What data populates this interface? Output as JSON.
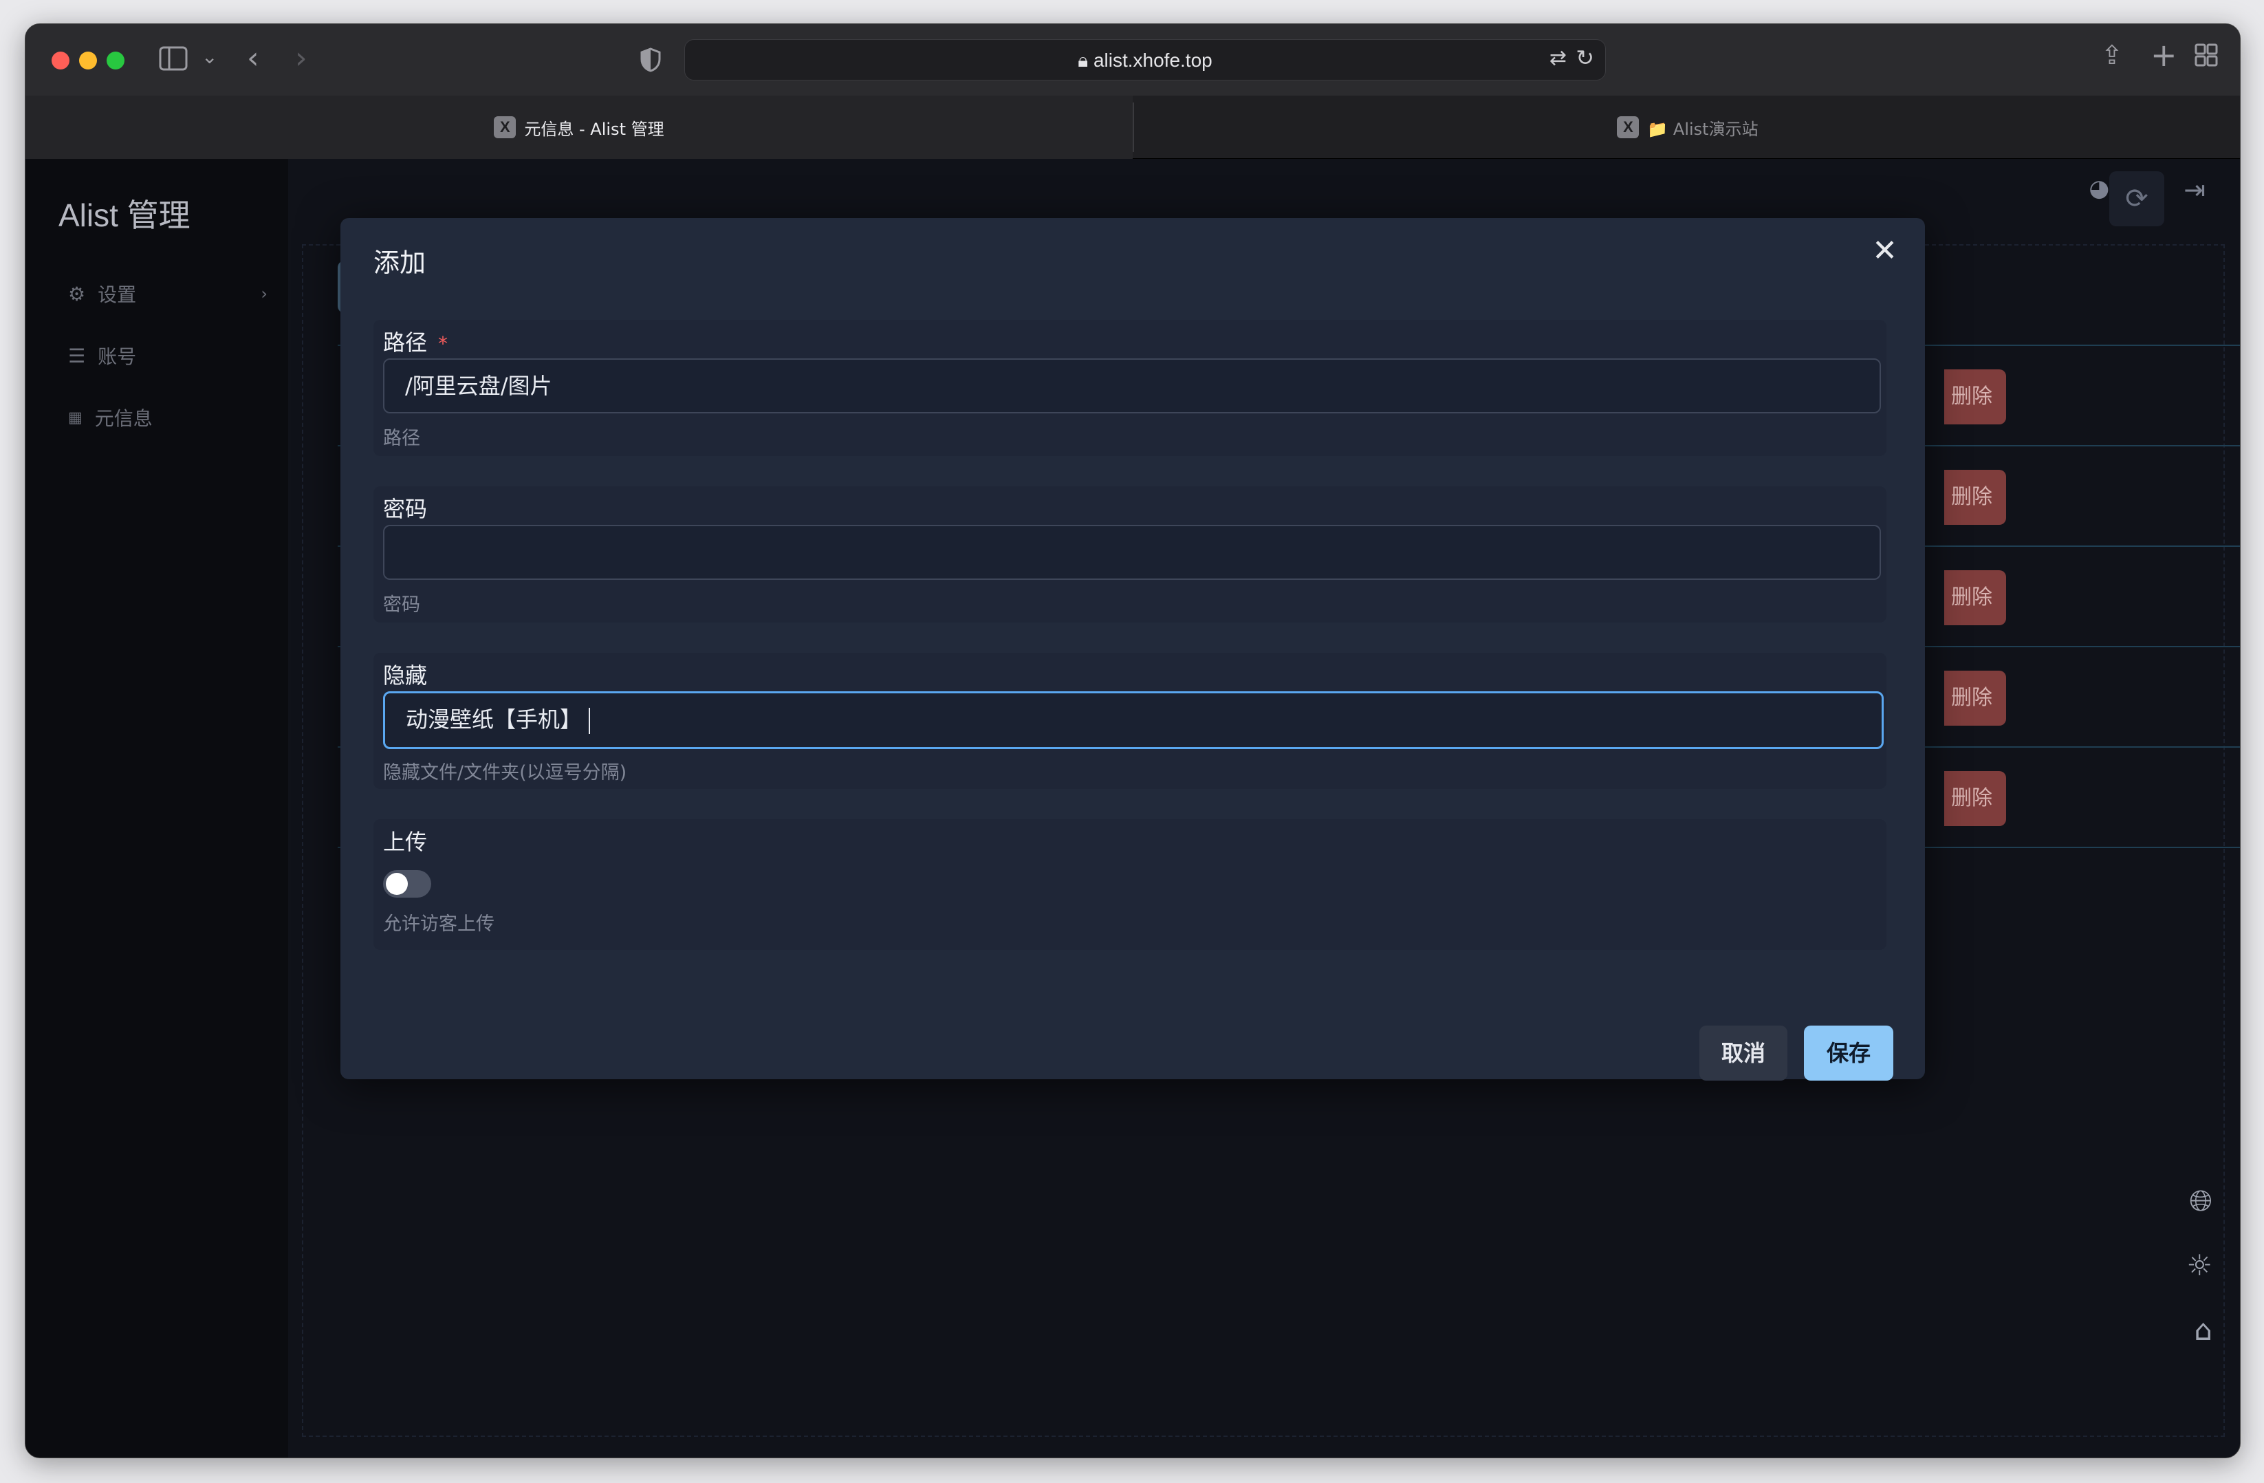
{
  "browser": {
    "address": "alist.xhofe.top",
    "tabs": [
      {
        "label": "元信息 - Alist 管理",
        "favicon": "X"
      },
      {
        "label": "📁 Alist演示站",
        "favicon": "X"
      }
    ]
  },
  "sidebar": {
    "brand": "Alist 管理",
    "items": [
      {
        "label": "设置",
        "icon": "gear-icon"
      },
      {
        "label": "账号",
        "icon": "list-icon"
      },
      {
        "label": "元信息",
        "icon": "table-icon"
      }
    ]
  },
  "table": {
    "delete_label": "删除"
  },
  "modal": {
    "title": "添加",
    "fields": {
      "path": {
        "label": "路径",
        "required": "*",
        "value": "/阿里云盘/图片",
        "help": "路径"
      },
      "password": {
        "label": "密码",
        "value": "",
        "help": "密码"
      },
      "hide": {
        "label": "隐藏",
        "value": "动漫壁纸【手机】",
        "help": "隐藏文件/文件夹(以逗号分隔)"
      },
      "upload": {
        "label": "上传",
        "enabled": false,
        "help": "允许访客上传"
      }
    },
    "cancel_label": "取消",
    "save_label": "保存"
  },
  "colors": {
    "accent": "#8dc8f7",
    "danger": "#7f3d3c",
    "modal_bg": "#222a3b"
  }
}
